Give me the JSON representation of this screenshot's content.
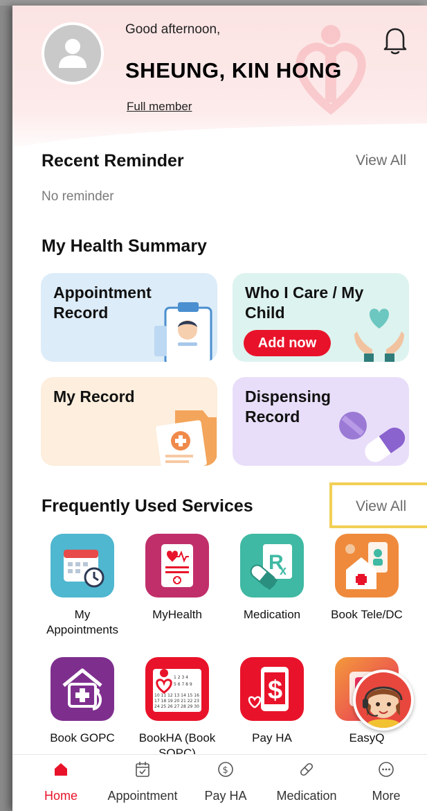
{
  "header": {
    "greeting": "Good afternoon,",
    "user_name": "SHEUNG, KIN HONG",
    "member_status": "Full member"
  },
  "reminder": {
    "title": "Recent Reminder",
    "view_all": "View All",
    "empty_text": "No reminder"
  },
  "health_summary": {
    "title": "My Health Summary",
    "cards": [
      {
        "title": "Appointment Record"
      },
      {
        "title": "Who I Care / My Child",
        "button": "Add now"
      },
      {
        "title": "My Record"
      },
      {
        "title": "Dispensing Record"
      }
    ]
  },
  "services": {
    "title": "Frequently Used Services",
    "view_all": "View All",
    "items": [
      {
        "label": "My Appointments",
        "icon": "calendar-clock-icon"
      },
      {
        "label": "MyHealth",
        "icon": "health-notebook-icon"
      },
      {
        "label": "Medication",
        "icon": "rx-pill-icon"
      },
      {
        "label": "Book Tele/DC",
        "icon": "home-teleconsult-icon"
      },
      {
        "label": "Book GOPC",
        "icon": "house-stethoscope-icon"
      },
      {
        "label": "BookHA (Book SOPC)",
        "icon": "ha-calendar-icon"
      },
      {
        "label": "Pay HA",
        "icon": "pay-phone-icon"
      },
      {
        "label": "EasyQ",
        "icon": "easyq-icon"
      }
    ]
  },
  "tabbar": {
    "tabs": [
      {
        "label": "Home",
        "icon": "home-icon",
        "active": true
      },
      {
        "label": "Appointment",
        "icon": "calendar-check-icon"
      },
      {
        "label": "Pay HA",
        "icon": "dollar-circle-icon"
      },
      {
        "label": "Medication",
        "icon": "pill-icon"
      },
      {
        "label": "More",
        "icon": "more-dots-icon"
      }
    ]
  },
  "colors": {
    "accent_red": "#e8132a",
    "header_pink": "#fbe3e3",
    "highlight_yellow": "#f2cf55"
  }
}
